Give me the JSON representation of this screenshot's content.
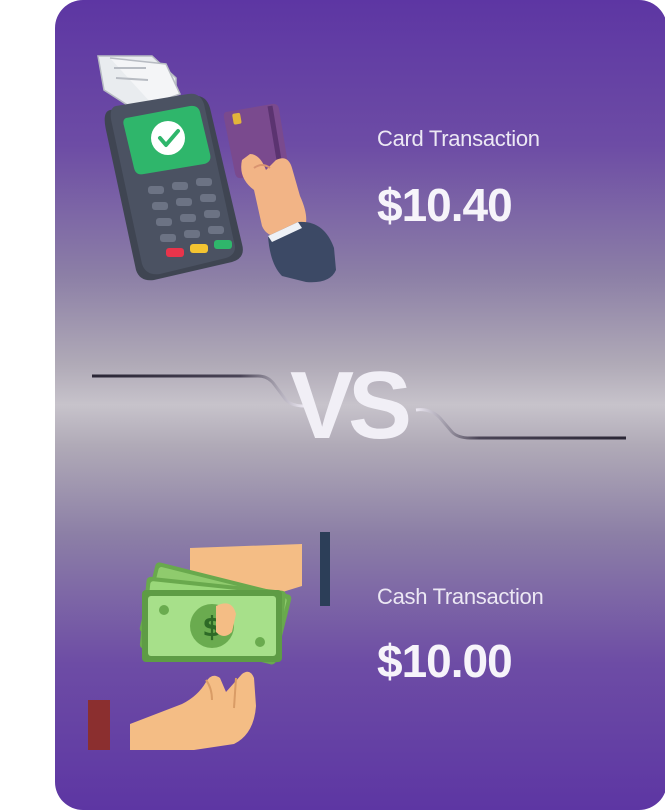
{
  "card_section": {
    "label": "Card Transaction",
    "amount": "$10.40",
    "illustration": "card-terminal-icon"
  },
  "divider": {
    "text": "VS"
  },
  "cash_section": {
    "label": "Cash Transaction",
    "amount": "$10.00",
    "illustration": "cash-handover-icon"
  },
  "colors": {
    "card_top": "#5d36a3",
    "card_middle": "#c7c3cb",
    "text": "#f6f4fa"
  }
}
